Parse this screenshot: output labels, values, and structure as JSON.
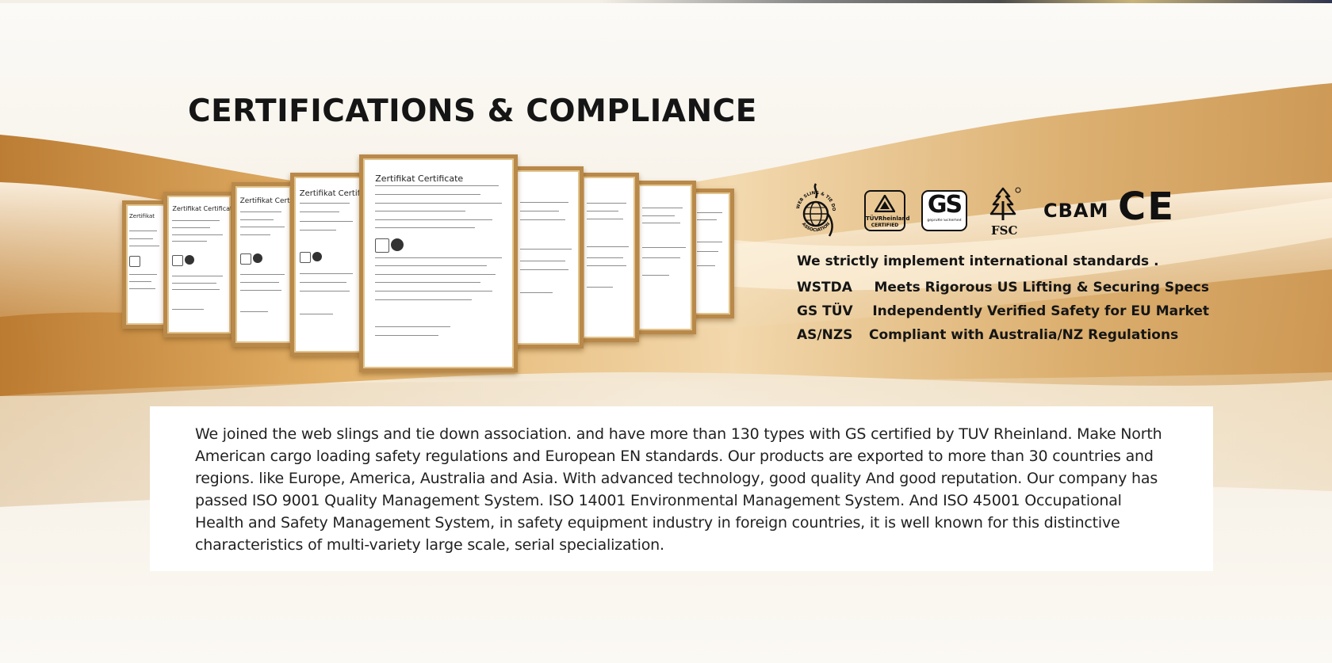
{
  "page": {
    "title": "CERTIFICATIONS & COMPLIANCE"
  },
  "certificates": [
    {
      "heading": "Zertifikat"
    },
    {
      "heading": "Zertifikat Certificate"
    },
    {
      "heading": "Zertifikat Certificate"
    },
    {
      "heading": "Zertifikat Certificate"
    },
    {
      "heading": "Zertifikat Certificate"
    },
    {
      "heading": ""
    },
    {
      "heading": ""
    },
    {
      "heading": ""
    },
    {
      "heading": ""
    }
  ],
  "logos": {
    "wstda": {
      "top_text": "WEB SLING & TIE DOWN",
      "bottom_text": "ASSOCIATION"
    },
    "tuv": {
      "brand": "TÜVRheinland",
      "label": "CERTIFIED"
    },
    "gs": {
      "brand": "GS",
      "sub": "geprüfte Sicherheit"
    },
    "fsc": {
      "label": "FSC"
    },
    "cbam": {
      "label": "CBAM"
    },
    "ce": {
      "label": "CE"
    }
  },
  "standards": {
    "headline": "We strictly implement international standards .",
    "items": [
      {
        "code": "WSTDA",
        "desc": "Meets Rigorous US Lifting & Securing Specs"
      },
      {
        "code": "GS TÜV",
        "desc": "Independently Verified Safety for EU Market"
      },
      {
        "code": "AS/NZS",
        "desc": "Compliant with Australia/NZ Regulations"
      }
    ]
  },
  "about": {
    "text": "We joined the web slings and tie down association. and have more than 130 types with GS certified by TUV Rheinland. Make North American cargo loading safety regulations and European EN standards. Our products are exported to more than 30 countries and regions. like Europe, America, Australia and Asia. With advanced technology, good quality And good reputation. Our company has passed ISO 9001 Quality Management System. ISO 14001 Environmental Management System. And ISO 45001 Occupational Health and Safety Management System, in safety equipment industry in foreign countries, it is well known for this distinctive characteristics of multi-variety large scale, serial specialization."
  },
  "colors": {
    "gold": "#c99a52",
    "text": "#151515",
    "frame": "#b9894a"
  }
}
